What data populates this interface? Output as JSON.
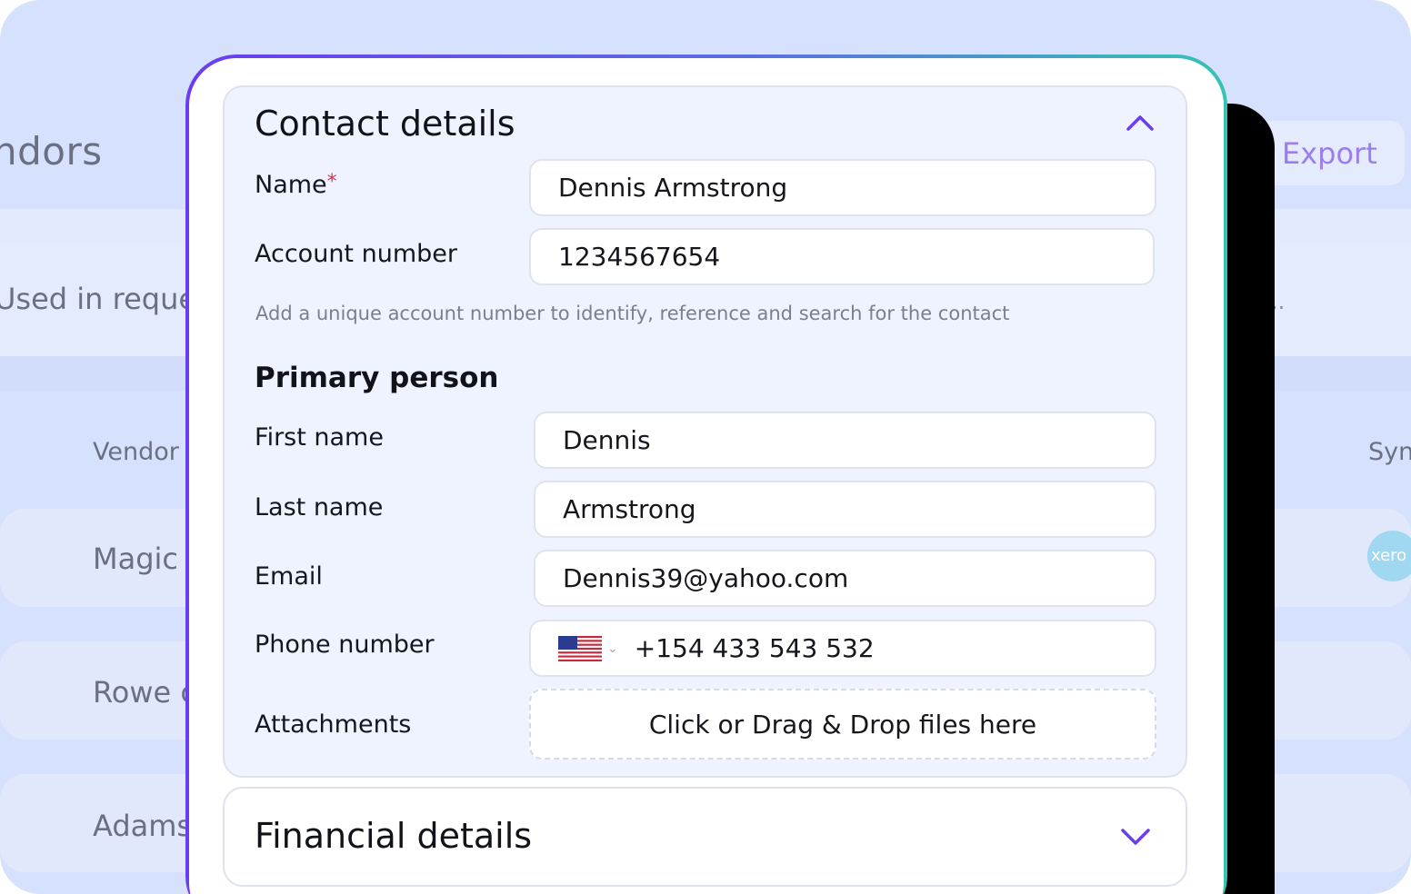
{
  "background": {
    "page_title": "ndors",
    "tab_label": "Used in reque",
    "columns": {
      "vendor": "Vendor",
      "sync": "Syn"
    },
    "rows": [
      "Magic",
      "Rowe c",
      "Adams"
    ],
    "export_label": "Export",
    "right_dots": "..",
    "xero_badge": "xero"
  },
  "contact": {
    "title": "Contact details",
    "name_label": "Name",
    "required_mark": "*",
    "name_value": "Dennis Armstrong",
    "account_label": "Account number",
    "account_value": "1234567654",
    "account_hint": "Add a unique account number to identify, reference and search for the contact"
  },
  "primary": {
    "title": "Primary person",
    "first_name_label": "First name",
    "first_name_value": "Dennis",
    "last_name_label": "Last name",
    "last_name_value": "Armstrong",
    "email_label": "Email",
    "email_value": "Dennis39@yahoo.com",
    "phone_label": "Phone number",
    "phone_country": "us-flag-icon",
    "phone_value": "+154 433 543 532",
    "attachments_label": "Attachments",
    "dropzone_text": "Click or Drag & Drop files here"
  },
  "financial": {
    "title": "Financial details"
  },
  "colors": {
    "accent": "#6a3df0",
    "teal": "#36c3b4",
    "card_bg": "#eff3ff",
    "page_bg": "#d6e1fd"
  }
}
